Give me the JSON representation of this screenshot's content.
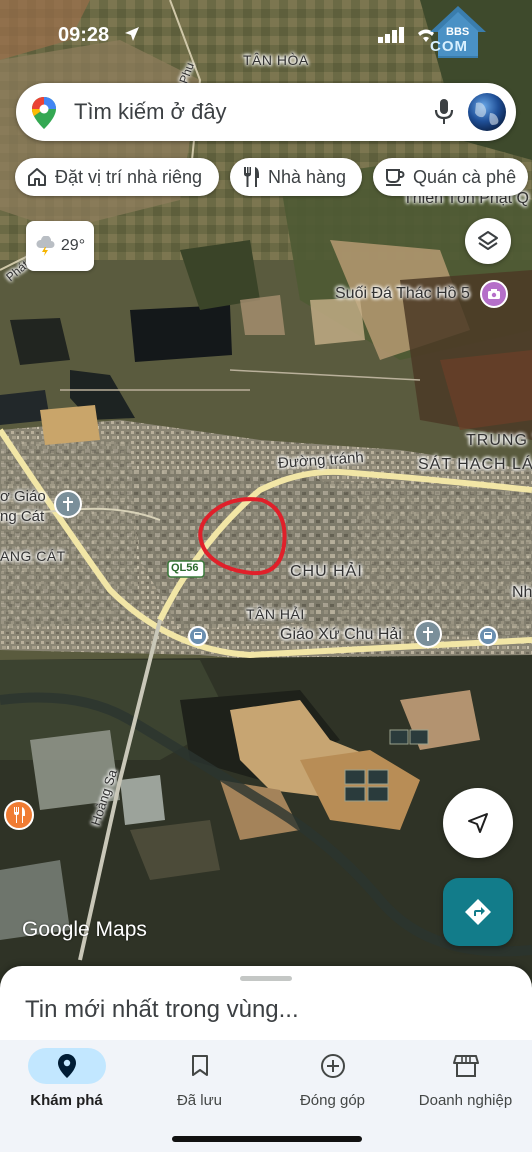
{
  "status_bar": {
    "time": "09:28",
    "watermark_text": "COM",
    "watermark_small": "BBS"
  },
  "search": {
    "placeholder": "Tìm kiếm ở đây"
  },
  "chips": [
    {
      "label": "Đặt vị trí nhà riêng",
      "icon": "home-icon"
    },
    {
      "label": "Nhà hàng",
      "icon": "restaurant-icon"
    },
    {
      "label": "Quán cà phê",
      "icon": "coffee-icon"
    }
  ],
  "weather": {
    "temperature": "29°",
    "icon": "thunderstorm-icon"
  },
  "map_labels": {
    "tan_hoa": "TÂN HÒA",
    "thien_ton": "Thiên Tôn Phật Q",
    "suoi_da": "Suối Đá Thác Hồ 5",
    "trung_t": "TRUNG T",
    "sat_hach": "SÁT HẠCH LÁI X",
    "duong_tranh": "Đường tránh",
    "giao_left1": "ơ Giáo",
    "giao_left2": "ng Cát",
    "ang_cat": "ANG CÁT",
    "ql56": "QL56",
    "chu_hai": "CHU HẢI",
    "tan_hai": "TÂN HẢI",
    "giao_xu": "Giáo Xứ Chu Hải",
    "nh": "Nh",
    "hoang_sa": "Hoàng Sa",
    "phu": "Phu",
    "phat_road": "Phát Phạ",
    "sa_right": "S"
  },
  "brand": "Google Maps",
  "sheet": {
    "title": "Tin mới nhất trong vùng..."
  },
  "nav": [
    {
      "label": "Khám phá",
      "icon": "explore-pin-icon",
      "active": true
    },
    {
      "label": "Đã lưu",
      "icon": "bookmark-icon",
      "active": false
    },
    {
      "label": "Đóng góp",
      "icon": "add-circle-icon",
      "active": false
    },
    {
      "label": "Doanh nghiệp",
      "icon": "storefront-icon",
      "active": false
    }
  ],
  "colors": {
    "directions_button": "#127c8a",
    "nav_active_pill": "#c2e7ff",
    "highlight_circle": "#e0202a",
    "road_main": "#f2e6a6"
  }
}
